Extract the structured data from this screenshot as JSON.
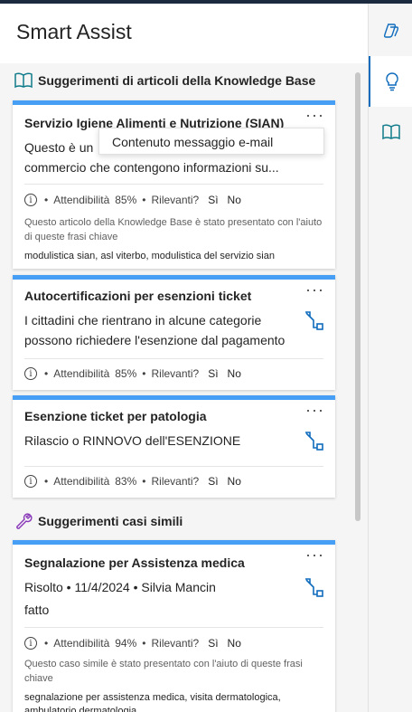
{
  "app": {
    "title": "Smart Assist"
  },
  "sections": {
    "kb": {
      "title": "Suggerimenti di articoli della Knowledge Base"
    },
    "cases": {
      "title": "Suggerimenti casi simili"
    }
  },
  "labels": {
    "reliability": "Attendibilità",
    "relevant": "Rilevanti?",
    "yes": "Sì",
    "no": "No",
    "more": "···"
  },
  "cards": [
    {
      "title": "Servizio Igiene Alimenti e Nutrizione (SIAN)",
      "line1": "Questo è un",
      "line2": "commercio che contengono informazioni su...",
      "reliability": "85%",
      "note": "Questo articolo della Knowledge Base è stato presentato con l'aiuto di queste frasi chiave",
      "keys": "modulistica sian, asl viterbo, modulistica del servizio sian",
      "tooltip": "Contenuto messaggio e-mail"
    },
    {
      "title": "Autocertificazioni per esenzioni ticket",
      "line1": "I cittadini che rientrano in alcune categorie",
      "line2": "possono richiedere l'esenzione dal pagamento",
      "reliability": "85%"
    },
    {
      "title": "Esenzione ticket per patologia",
      "line1": "Rilascio o RINNOVO dell'ESENZIONE",
      "reliability": "83%"
    },
    {
      "title": "Segnalazione per Assistenza medica",
      "line1": "Risolto • 11/4/2024 • Silvia Mancin",
      "line2": "fatto",
      "reliability": "94%",
      "note": "Questo caso simile è stato presentato con l'aiuto di queste frasi chiave",
      "keys": "segnalazione per assistenza medica, visita dermatologica, ambulatorio dermatologia"
    }
  ],
  "colors": {
    "accent": "#479ef5",
    "icon": "#0f6cbd",
    "kb_icon": "#0f7b8a",
    "case_icon": "#8a3ab9"
  }
}
